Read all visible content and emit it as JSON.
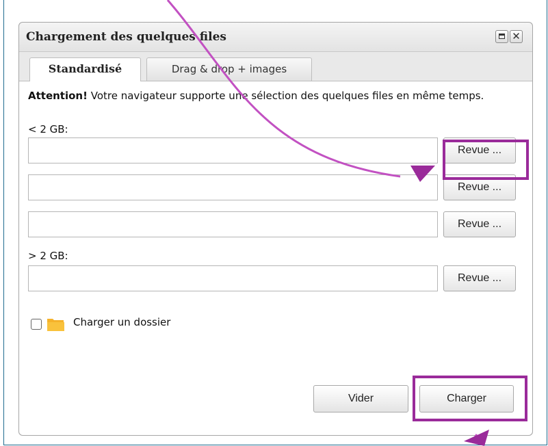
{
  "dialog": {
    "title": "Chargement des quelques files",
    "close_glyph": "✕",
    "tabs": [
      {
        "label": "Standardisé",
        "active": true
      },
      {
        "label": "Drag & drop + images",
        "active": false
      }
    ]
  },
  "notice": {
    "bold": "Attention!",
    "text": " Votre navigateur supporte une sélection des quelques files en même temps."
  },
  "small_label": "< 2 GB:",
  "large_label": "> 2 GB:",
  "browse_label": "Revue ...",
  "folder": {
    "label": "Charger un dossier",
    "checked": false
  },
  "buttons": {
    "clear": "Vider",
    "upload": "Charger"
  },
  "colors": {
    "highlight": "#9a2b9a",
    "arrow": "#c251c2"
  }
}
